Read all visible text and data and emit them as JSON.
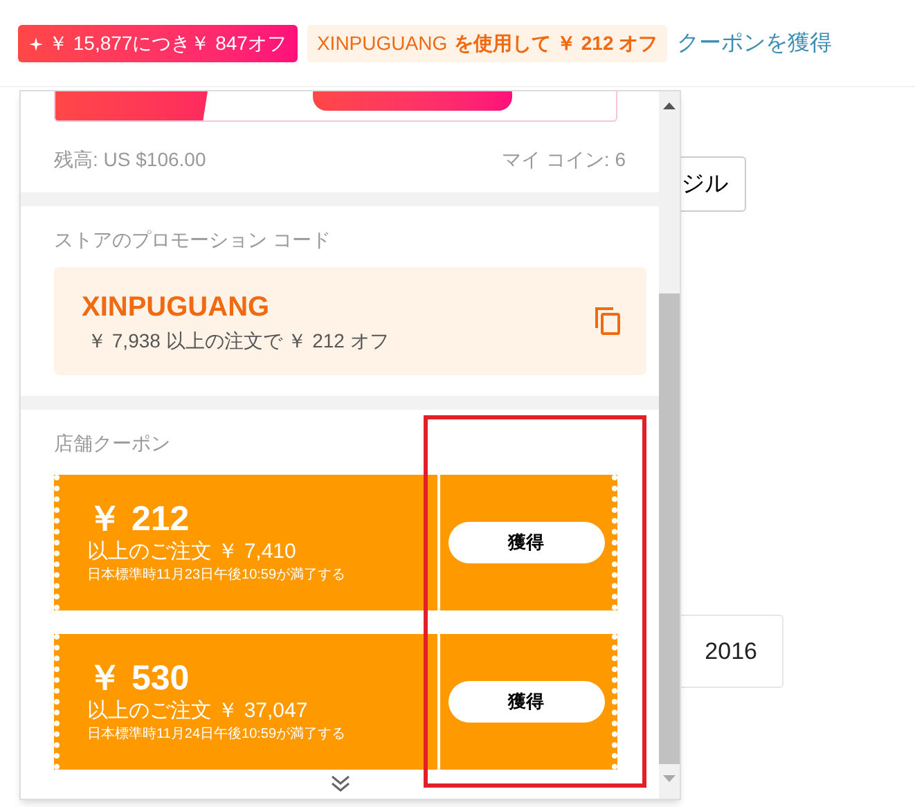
{
  "top_bar": {
    "promo_badge": "￥ 15,877につき￥ 847オフ",
    "code_badge": {
      "code": "XINPUGUANG",
      "text": "を使用して ￥ 212 オフ"
    },
    "link": "クーポンを獲得"
  },
  "background_buttons": [
    "ジル",
    "2016"
  ],
  "popup": {
    "balance": "残高: US $106.00",
    "coins": "マイ コイン: 6",
    "promo_code": {
      "title": "ストアのプロモーション コード",
      "code": "XINPUGUANG",
      "condition": "￥ 7,938 以上の注文で ￥ 212 オフ"
    },
    "store_coupons": {
      "title": "店舗クーポン",
      "coupons": [
        {
          "amount": "￥ 212",
          "minimum": "以上のご注文 ￥ 7,410",
          "expiry": "日本標準時11月23日午後10:59が満了する",
          "button": "獲得"
        },
        {
          "amount": "￥ 530",
          "minimum": "以上のご注文 ￥ 37,047",
          "expiry": "日本標準時11月24日午後10:59が満了する",
          "button": "獲得"
        }
      ]
    }
  }
}
